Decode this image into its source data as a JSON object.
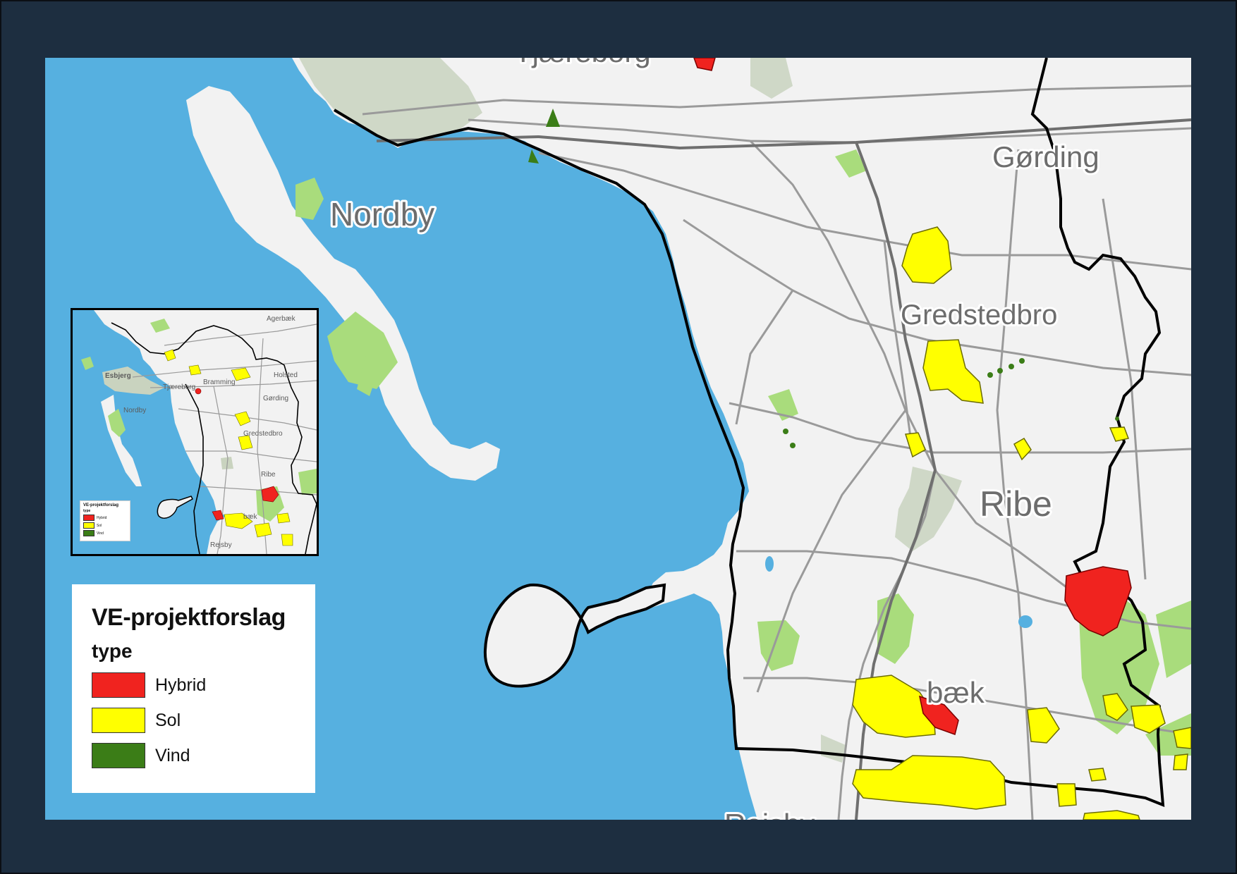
{
  "map": {
    "towns": {
      "tjaereborg": "Tjæreborg",
      "gording": "Gørding",
      "nordby": "Nordby",
      "gredstedbro": "Gredstedbro",
      "ribe": "Ribe",
      "rejsby": "Rejsby",
      "hviding_partial": "bæk"
    }
  },
  "inset": {
    "towns": {
      "agerbaek": "Agerbæk",
      "esbjerg": "Esbjerg",
      "tjaereborg": "Tjæreborg",
      "bramming": "Bramming",
      "holsted": "Holsted",
      "gording": "Gørding",
      "nordby": "Nordby",
      "gredstedbro": "Gredstedbro",
      "ribe": "Ribe",
      "hviding_partial": "bæk",
      "rejsby": "Rejsby"
    }
  },
  "legend": {
    "title": "VE-projektforslag",
    "subtitle": "type",
    "items": [
      {
        "label": "Hybrid",
        "color": "#f0231f"
      },
      {
        "label": "Sol",
        "color": "#ffff00"
      },
      {
        "label": "Vind",
        "color": "#3b7d17"
      }
    ]
  },
  "colors": {
    "frame": "#1d2e40",
    "sea": "#56b0e0",
    "land": "#f2f2f2",
    "forest": "#a9dc7c",
    "urban": "#c9d3bf",
    "road": "#9a9a9a",
    "boundary": "#000000"
  }
}
